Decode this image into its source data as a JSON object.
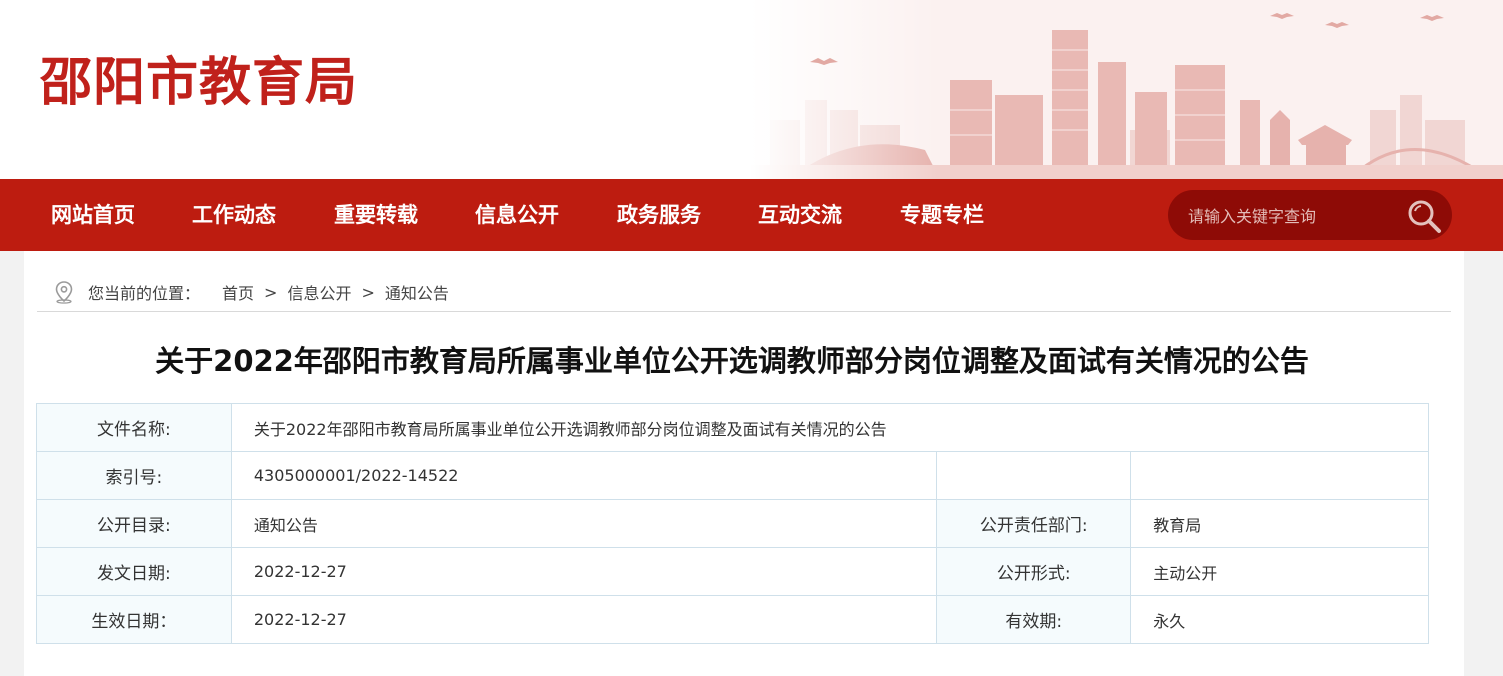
{
  "site": {
    "logo_text": "邵阳市教育局"
  },
  "nav": {
    "items": [
      {
        "label": "网站首页"
      },
      {
        "label": "工作动态"
      },
      {
        "label": "重要转载"
      },
      {
        "label": "信息公开"
      },
      {
        "label": "政务服务"
      },
      {
        "label": "互动交流"
      },
      {
        "label": "专题专栏"
      }
    ],
    "search_placeholder": "请输入关键字查询"
  },
  "breadcrumb": {
    "label": "您当前的位置：",
    "items": [
      "首页",
      "信息公开",
      "通知公告"
    ],
    "separator": ">"
  },
  "article": {
    "title": "关于2022年邵阳市教育局所属事业单位公开选调教师部分岗位调整及面试有关情况的公告"
  },
  "meta": {
    "file_name_label": "文件名称:",
    "file_name": "关于2022年邵阳市教育局所属事业单位公开选调教师部分岗位调整及面试有关情况的公告",
    "index_label": "索引号:",
    "index": "4305000001/2022-14522",
    "catalog_label": "公开目录:",
    "catalog": "通知公告",
    "dept_label": "公开责任部门:",
    "dept": "教育局",
    "issue_date_label": "发文日期:",
    "issue_date": "2022-12-27",
    "form_label": "公开形式:",
    "form": "主动公开",
    "effective_date_label": "生效日期：",
    "effective_date": "2022-12-27",
    "validity_label": "有效期:",
    "validity": "永久"
  },
  "colors": {
    "brand_red": "#bd1c10",
    "search_bg": "#8e0b06",
    "logo": "#c0211b"
  }
}
